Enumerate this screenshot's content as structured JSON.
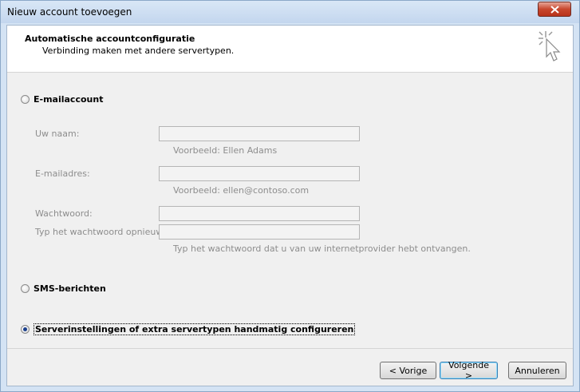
{
  "window": {
    "title": "Nieuw account toevoegen"
  },
  "header": {
    "title": "Automatische accountconfiguratie",
    "subtitle": "Verbinding maken met andere servertypen."
  },
  "options": {
    "email_account": "E-mailaccount",
    "sms": "SMS-berichten",
    "manual": "Serverinstellingen of extra servertypen handmatig configureren",
    "selected": "manual"
  },
  "form": {
    "name_label": "Uw naam:",
    "name_value": "",
    "name_hint": "Voorbeeld: Ellen Adams",
    "email_label": "E-mailadres:",
    "email_value": "",
    "email_hint": "Voorbeeld: ellen@contoso.com",
    "password_label": "Wachtwoord:",
    "password_value": "",
    "password_confirm_label": "Typ het wachtwoord opnieuw:",
    "password_confirm_value": "",
    "password_hint": "Typ het wachtwoord dat u van uw internetprovider hebt ontvangen."
  },
  "buttons": {
    "back": "< Vorige",
    "next": "Volgende >",
    "cancel": "Annuleren"
  }
}
